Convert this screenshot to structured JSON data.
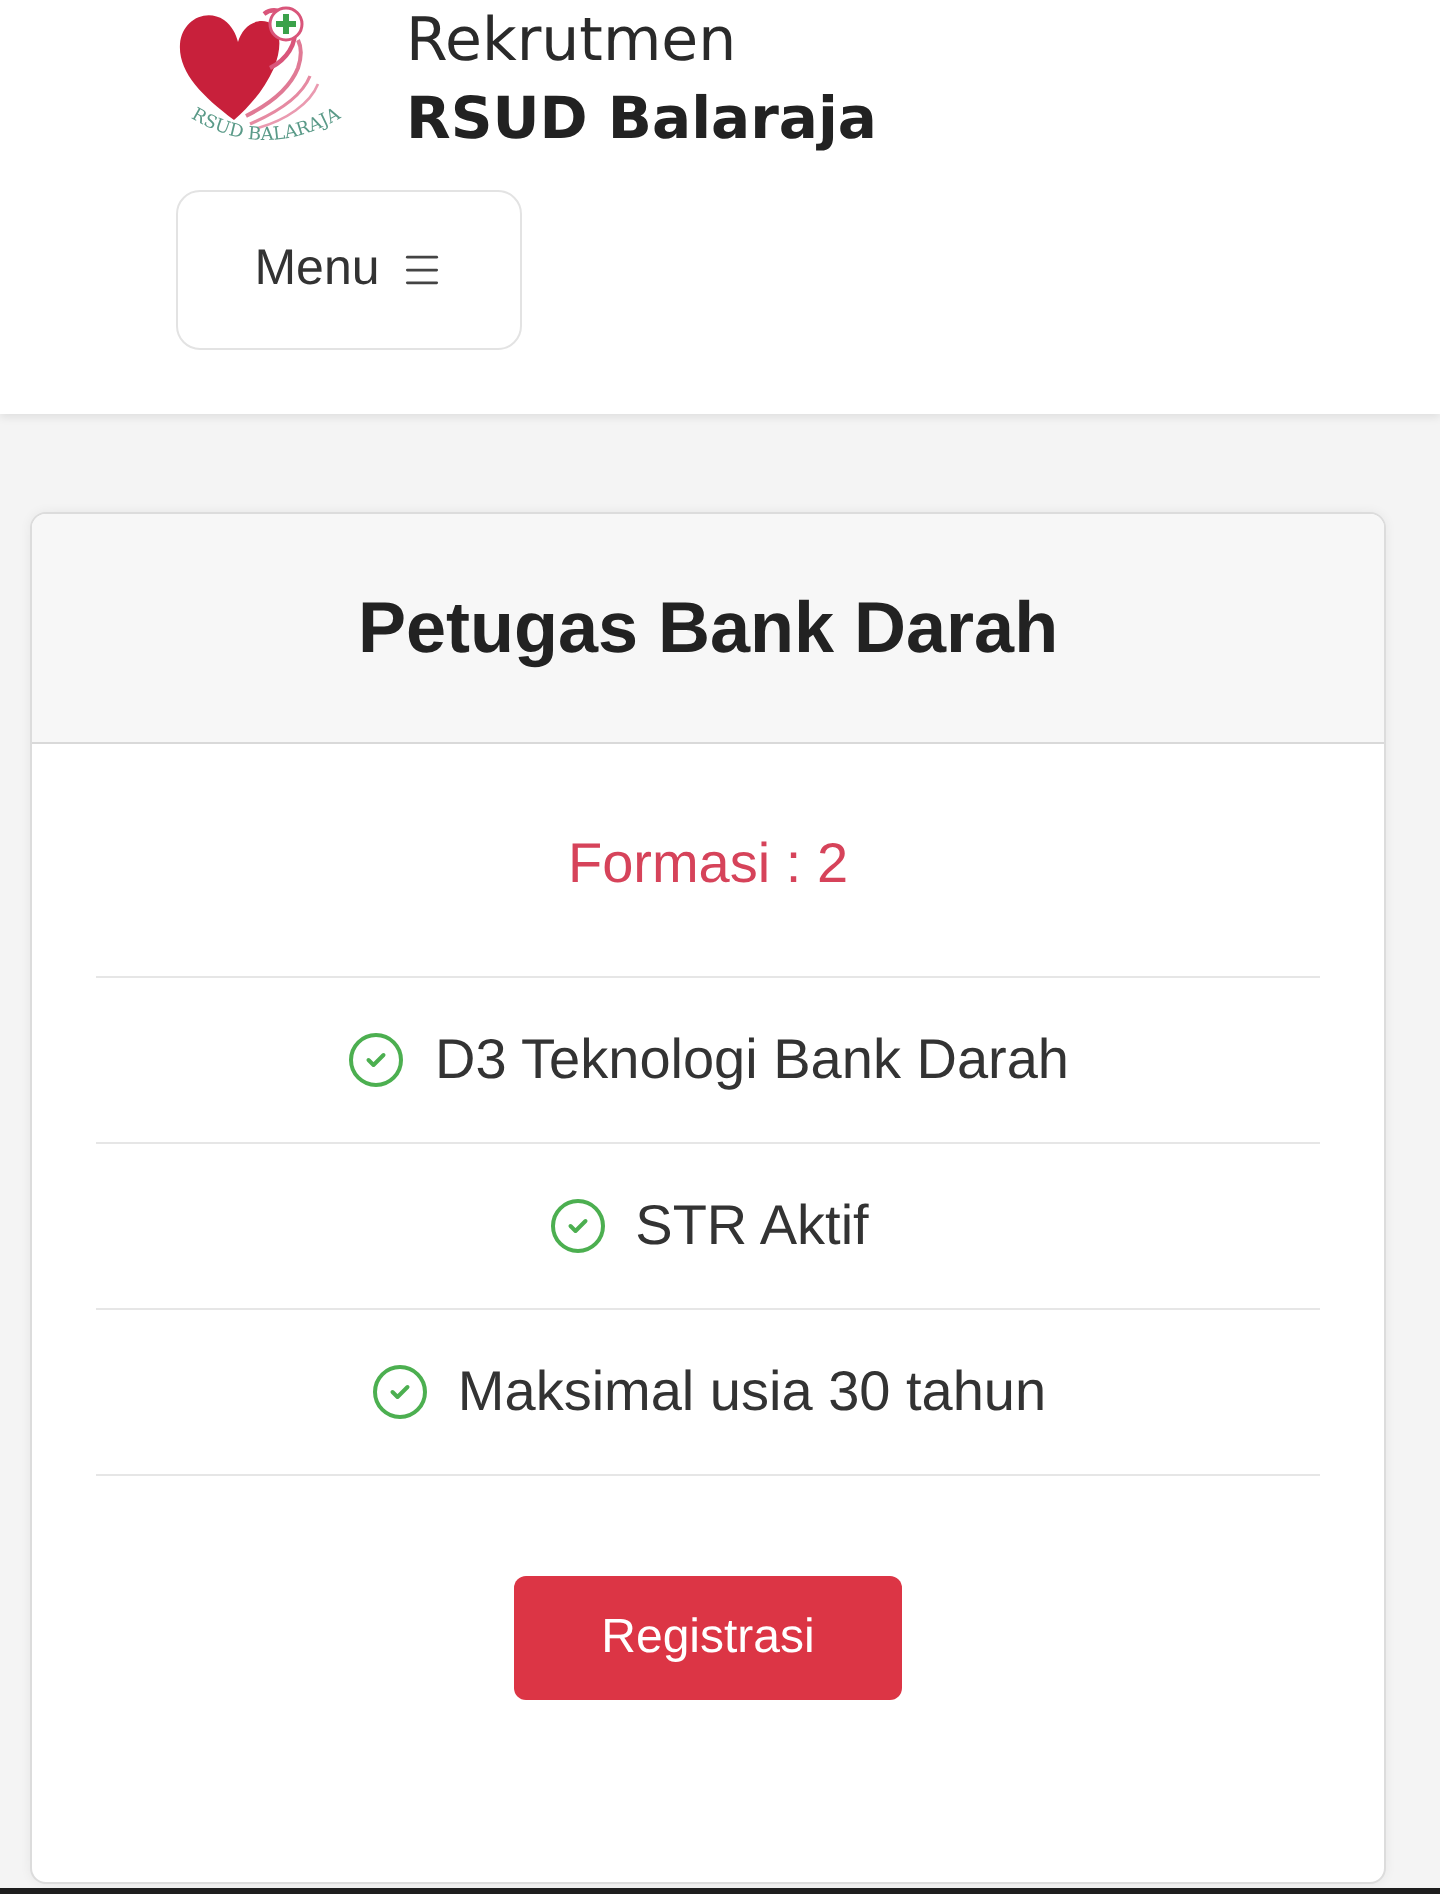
{
  "header": {
    "logo_text": "RSUD BALARAJA",
    "title": "Rekrutmen",
    "subtitle": "RSUD Balaraja",
    "menu_button": "Menu"
  },
  "card": {
    "title": "Petugas Bank Darah",
    "quota": "Formasi : 2",
    "requirements": [
      {
        "text": "D3 Teknologi Bank Darah",
        "checked": true
      },
      {
        "text": "STR Aktif",
        "checked": true
      },
      {
        "text": "Maksimal usia 30 tahun",
        "checked": true
      }
    ],
    "button": "Registrasi"
  }
}
